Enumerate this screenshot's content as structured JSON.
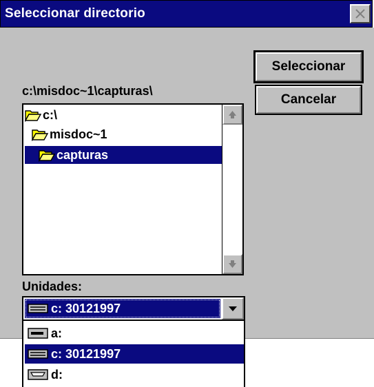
{
  "window": {
    "title": "Seleccionar directorio"
  },
  "path": {
    "current": "c:\\misdoc~1\\capturas\\"
  },
  "directories": [
    {
      "label": "c:\\",
      "icon": "open-folder-icon",
      "selected": false
    },
    {
      "label": "misdoc~1",
      "icon": "open-folder-icon",
      "selected": false
    },
    {
      "label": "capturas",
      "icon": "open-folder-icon",
      "selected": true
    }
  ],
  "buttons": {
    "select_label": "Seleccionar",
    "cancel_label": "Cancelar"
  },
  "drives": {
    "label": "Unidades:",
    "selected": "c: 30121997",
    "options": [
      {
        "label": "a:",
        "icon": "floppy-drive-icon",
        "selected": false
      },
      {
        "label": "c: 30121997",
        "icon": "hard-drive-icon",
        "selected": true
      },
      {
        "label": "d:",
        "icon": "cdrom-drive-icon",
        "selected": false
      }
    ]
  },
  "colors": {
    "titlebar": "#0a0a80",
    "selection": "#0a0a80",
    "face": "#c0c0c0"
  }
}
